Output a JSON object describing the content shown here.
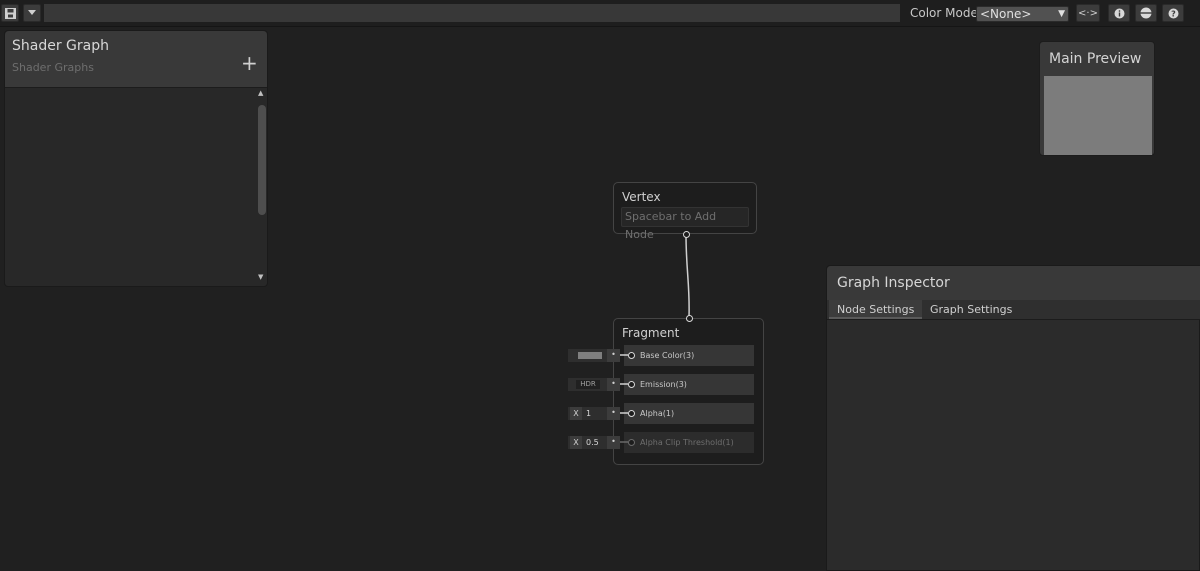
{
  "toolbar": {
    "save_icon": "save-icon",
    "dropdown_icon": "chevron-down-icon",
    "color_mode_label": "Color Mode",
    "color_mode_value": "<None>",
    "buttons": [
      "code-icon",
      "info-icon",
      "sphere-preview-icon",
      "help-icon"
    ],
    "code_button_label": "<·>"
  },
  "blackboard": {
    "title": "Shader Graph",
    "subtitle": "Shader Graphs",
    "add_label": "+"
  },
  "main_preview": {
    "title": "Main Preview"
  },
  "vertex": {
    "title": "Vertex",
    "hint": "Spacebar to Add Node"
  },
  "fragment": {
    "title": "Fragment",
    "slots": [
      {
        "label": "Base Color(3)"
      },
      {
        "label": "Emission(3)"
      },
      {
        "label": "Alpha(1)"
      },
      {
        "label": "Alpha Clip Threshold(1)"
      }
    ],
    "inputs": {
      "emission_tag": "HDR",
      "alpha_axis": "X",
      "alpha_value": "1",
      "clip_axis": "X",
      "clip_value": "0.5"
    }
  },
  "inspector": {
    "title": "Graph Inspector",
    "tabs": [
      "Node Settings",
      "Graph Settings"
    ]
  }
}
